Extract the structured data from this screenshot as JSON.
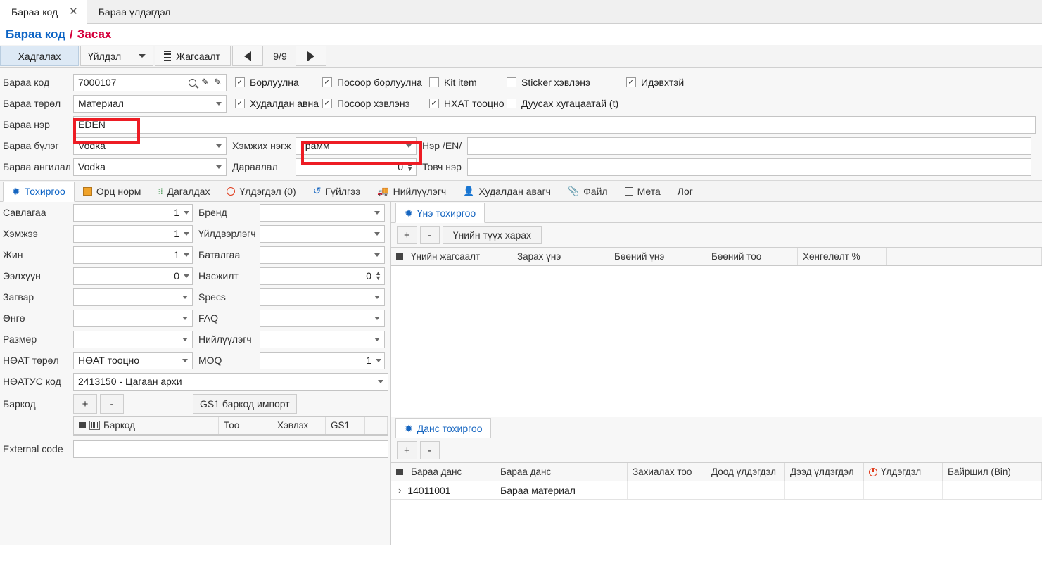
{
  "window": {
    "tabs": [
      {
        "label": "Бараа код",
        "active": true,
        "closable": true
      },
      {
        "label": "Бараа үлдэгдэл",
        "active": false,
        "closable": false
      }
    ]
  },
  "breadcrumb": {
    "root": "Бараа код",
    "separator": "/",
    "current": "Засах"
  },
  "toolbar": {
    "save_label": "Хадгалах",
    "action_label": "Үйлдэл",
    "list_label": "Жагсаалт",
    "prev_icon": "triangle-left-icon",
    "next_icon": "triangle-right-icon",
    "pager": "9/9"
  },
  "header": {
    "fields": {
      "item_code_label": "Бараа код",
      "item_code_value": "7000107",
      "item_type_label": "Бараа төрөл",
      "item_type_value": "Материал",
      "item_name_label": "Бараа нэр",
      "item_name_value": "EDEN",
      "item_group_label": "Бараа бүлэг",
      "item_group_value": "Vodka",
      "item_class_label": "Бараа ангилал",
      "item_class_value": "Vodka",
      "unit_label": "Хэмжих нэгж",
      "unit_value": "Грамм",
      "order_label": "Дараалал",
      "order_value": "0",
      "name_en_label": "Нэр /EN/",
      "name_en_value": "",
      "short_name_label": "Товч нэр",
      "short_name_value": ""
    },
    "checkboxes": [
      {
        "label": "Борлуулна",
        "checked": true
      },
      {
        "label": "Посоор борлуулна",
        "checked": true
      },
      {
        "label": "Kit item",
        "checked": false
      },
      {
        "label": "Sticker хэвлэнэ",
        "checked": false
      },
      {
        "label": "Идэвхтэй",
        "checked": true
      },
      {
        "label": "Худалдан авна",
        "checked": true
      },
      {
        "label": "Посоор хэвлэнэ",
        "checked": true
      },
      {
        "label": "НХАТ тооцно",
        "checked": true
      },
      {
        "label": "Дуусах хугацаатай (t)",
        "checked": false
      }
    ]
  },
  "inner_tabs": [
    {
      "label": "Тохиргоо",
      "icon": "gear-icon",
      "active": true
    },
    {
      "label": "Орц норм",
      "icon": "recipe-icon",
      "active": false
    },
    {
      "label": "Дагалдах",
      "icon": "hierarchy-icon",
      "active": false
    },
    {
      "label": "Үлдэгдэл (0)",
      "icon": "clock-icon",
      "active": false
    },
    {
      "label": "Гүйлгээ",
      "icon": "history-icon",
      "active": false
    },
    {
      "label": "Нийлүүлэгч",
      "icon": "truck-icon",
      "active": false
    },
    {
      "label": "Худалдан авагч",
      "icon": "person-icon",
      "active": false
    },
    {
      "label": "Файл",
      "icon": "paperclip-icon",
      "active": false
    },
    {
      "label": "Мета",
      "icon": "meta-icon",
      "active": false
    },
    {
      "label": "Лог",
      "icon": "",
      "active": false
    }
  ],
  "settings": {
    "left_column": [
      {
        "label": "Савлагаа",
        "value": "1",
        "type": "select"
      },
      {
        "label": "Хэмжээ",
        "value": "1",
        "type": "select"
      },
      {
        "label": "Жин",
        "value": "1",
        "type": "select"
      },
      {
        "label": "Ээлхүүн",
        "value": "0",
        "type": "select"
      },
      {
        "label": "Загвар",
        "value": "",
        "type": "select"
      },
      {
        "label": "Өнгө",
        "value": "",
        "type": "select"
      },
      {
        "label": "Размер",
        "value": "",
        "type": "select"
      },
      {
        "label": "НӨАТ төрөл",
        "value": "НӨАТ тооцно",
        "type": "select-left"
      }
    ],
    "mid_column": [
      {
        "label": "Бренд",
        "value": "",
        "type": "select"
      },
      {
        "label": "Үйлдвэрлэгч",
        "value": "",
        "type": "select"
      },
      {
        "label": "Баталгаа",
        "value": "",
        "type": "select"
      },
      {
        "label": "Насжилт",
        "value": "0",
        "type": "spinner"
      },
      {
        "label": "Specs",
        "value": "",
        "type": "select"
      },
      {
        "label": "FAQ",
        "value": "",
        "type": "select"
      },
      {
        "label": "Нийлүүлэгч",
        "value": "",
        "type": "select"
      },
      {
        "label": "MOQ",
        "value": "1",
        "type": "select"
      }
    ],
    "vat_code_label": "НӨАТУС код",
    "vat_code_value": "2413150 - Цагаан архи",
    "barcode_label": "Баркод",
    "barcode_add": "+",
    "barcode_remove": "-",
    "gs1_import_label": "GS1 баркод импорт",
    "barcode_columns": [
      "Баркод",
      "Тоо",
      "Хэвлэх",
      "GS1"
    ],
    "barcode_rows": [],
    "external_code_label": "External code",
    "external_code_value": ""
  },
  "price_panel": {
    "tab_label": "Үнэ тохиргоо",
    "tab_icon": "gear-icon",
    "add_label": "+",
    "remove_label": "-",
    "history_label": "Үнийн түүх харах",
    "columns": [
      "Үнийн жагсаалт",
      "Зарах үнэ",
      "Бөөний үнэ",
      "Бөөний тоо",
      "Хөнгөлөлт %",
      ""
    ],
    "rows": []
  },
  "account_panel": {
    "tab_label": "Данс тохиргоо",
    "tab_icon": "gear-icon",
    "add_label": "+",
    "remove_label": "-",
    "columns": [
      "Бараа данс",
      "Бараа данс",
      "Захиалах тоо",
      "Доод үлдэгдэл",
      "Дээд үлдэгдэл",
      "Үлдэгдэл",
      "Байршил (Bin)"
    ],
    "rows": [
      {
        "account": "14011001",
        "name": "Бараа материал",
        "order_qty": "",
        "min": "",
        "max": "",
        "balance": "",
        "bin": ""
      }
    ]
  },
  "colors": {
    "highlight": "#ed1c24",
    "accent": "#1565c0",
    "crumb_link": "#0b63c5",
    "crumb_current": "#d5003c"
  }
}
